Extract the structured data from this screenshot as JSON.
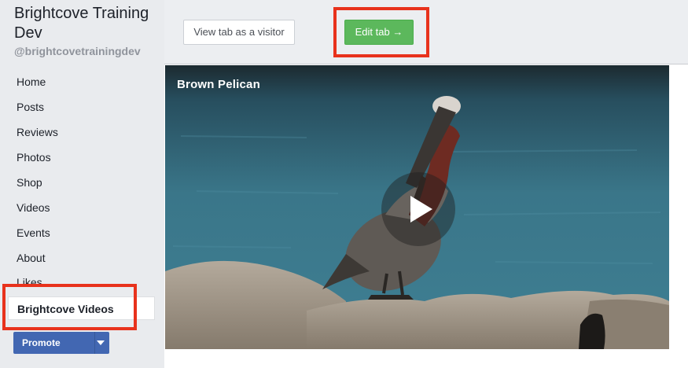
{
  "page": {
    "title": "Brightcove Training Dev",
    "handle": "@brightcovetrainingdev"
  },
  "sidebar": {
    "items": [
      {
        "label": "Home"
      },
      {
        "label": "Posts"
      },
      {
        "label": "Reviews"
      },
      {
        "label": "Photos"
      },
      {
        "label": "Shop"
      },
      {
        "label": "Videos"
      },
      {
        "label": "Events"
      },
      {
        "label": "About"
      },
      {
        "label": "Likes"
      }
    ],
    "active_item": "Brightcove Videos",
    "promote_label": "Promote"
  },
  "toolbar": {
    "view_as_visitor_label": "View tab as a visitor",
    "edit_tab_label": "Edit tab →"
  },
  "video": {
    "title": "Brown Pelican"
  },
  "colors": {
    "highlight": "#e8321c",
    "edit_button": "#5cb85c",
    "promote_button": "#4267b2",
    "sidebar_bg": "#e9ebee"
  },
  "icons": {
    "play": "play-icon",
    "promote_dropdown": "chevron-down-icon"
  }
}
